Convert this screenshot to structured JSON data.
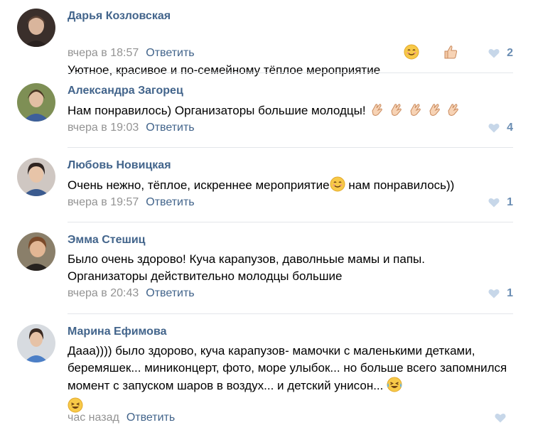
{
  "reply_label": "Ответить",
  "comments": [
    {
      "author": "Дарья Козловская",
      "text": "Уютное, красивое и по-семейному тёплое мероприятие",
      "emoji": [
        "smile",
        "thumbs-up"
      ],
      "time": "вчера в 18:57",
      "likes": "2"
    },
    {
      "author": "Александра Загорец",
      "text": "Нам понравилось) Организаторы большие молодцы!",
      "emoji": [
        "clap",
        "clap",
        "clap",
        "clap",
        "clap"
      ],
      "time": "вчера в 19:03",
      "likes": "4"
    },
    {
      "author": "Любовь Новицкая",
      "text_before": "Очень нежно, тёплое, искреннее мероприятие",
      "emoji": [
        "smile"
      ],
      "text_after": " нам понравилось))",
      "time": "вчера в 19:57",
      "likes": "1"
    },
    {
      "author": "Эмма Стешиц",
      "text": "Было очень здорово! Куча карапузов, даволньые мамы и папы. Организаторы действительно молодцы большие",
      "time": "вчера в 20:43",
      "likes": "1"
    },
    {
      "author": "Марина Ефимова",
      "text": "Дааа)))) было здорово, куча карапузов- мамочки с маленькими детками, беремяшек... миниконцерт, фото, море улыбок... но больше всего запомнился момент с запуском шаров в воздух... и детский унисон...",
      "emoji": [
        "laugh-tears",
        "laugh"
      ],
      "time": "час назад",
      "likes": ""
    }
  ],
  "colors": {
    "author": "#42648b",
    "meta": "#939393",
    "like": "#6a8db3",
    "divider": "#e3e6ea"
  }
}
